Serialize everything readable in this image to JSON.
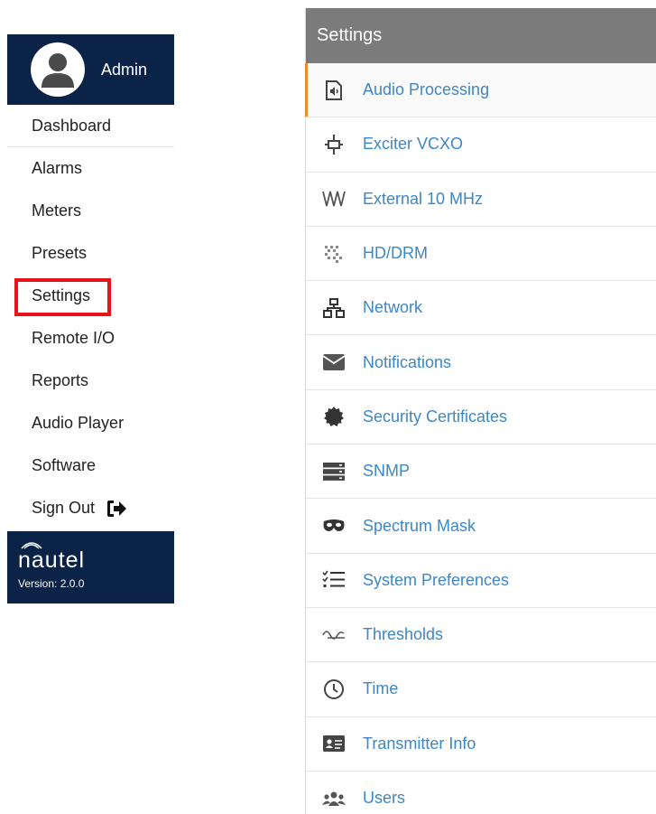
{
  "sidebar": {
    "user": {
      "name": "Admin"
    },
    "items": [
      {
        "label": "Dashboard"
      },
      {
        "label": "Alarms"
      },
      {
        "label": "Meters"
      },
      {
        "label": "Presets"
      },
      {
        "label": "Settings"
      },
      {
        "label": "Remote I/O"
      },
      {
        "label": "Reports"
      },
      {
        "label": "Audio Player"
      },
      {
        "label": "Software"
      },
      {
        "label": "Sign Out"
      }
    ],
    "brand": {
      "logo_text": "nautel",
      "version": "Version: 2.0.0"
    }
  },
  "settings": {
    "title": "Settings",
    "items": [
      {
        "label": "Audio Processing",
        "icon": "audio-processing-icon"
      },
      {
        "label": "Exciter VCXO",
        "icon": "exciter-vcxo-icon"
      },
      {
        "label": "External 10 MHz",
        "icon": "external-10mhz-icon"
      },
      {
        "label": "HD/DRM",
        "icon": "hd-drm-icon"
      },
      {
        "label": "Network",
        "icon": "network-icon"
      },
      {
        "label": "Notifications",
        "icon": "envelope-icon"
      },
      {
        "label": "Security Certificates",
        "icon": "certificate-seal-icon"
      },
      {
        "label": "SNMP",
        "icon": "server-stack-icon"
      },
      {
        "label": "Spectrum Mask",
        "icon": "mask-icon"
      },
      {
        "label": "System Preferences",
        "icon": "checklist-icon"
      },
      {
        "label": "Thresholds",
        "icon": "waveform-threshold-icon"
      },
      {
        "label": "Time",
        "icon": "clock-icon"
      },
      {
        "label": "Transmitter Info",
        "icon": "id-card-icon"
      },
      {
        "label": "Users",
        "icon": "users-icon"
      }
    ]
  },
  "colors": {
    "sidebar_bg": "#0b2347",
    "header_bg": "#7b7b7b",
    "link": "#3e86c5",
    "active_accent": "#f08a2a",
    "highlight_box": "#e8141c"
  }
}
